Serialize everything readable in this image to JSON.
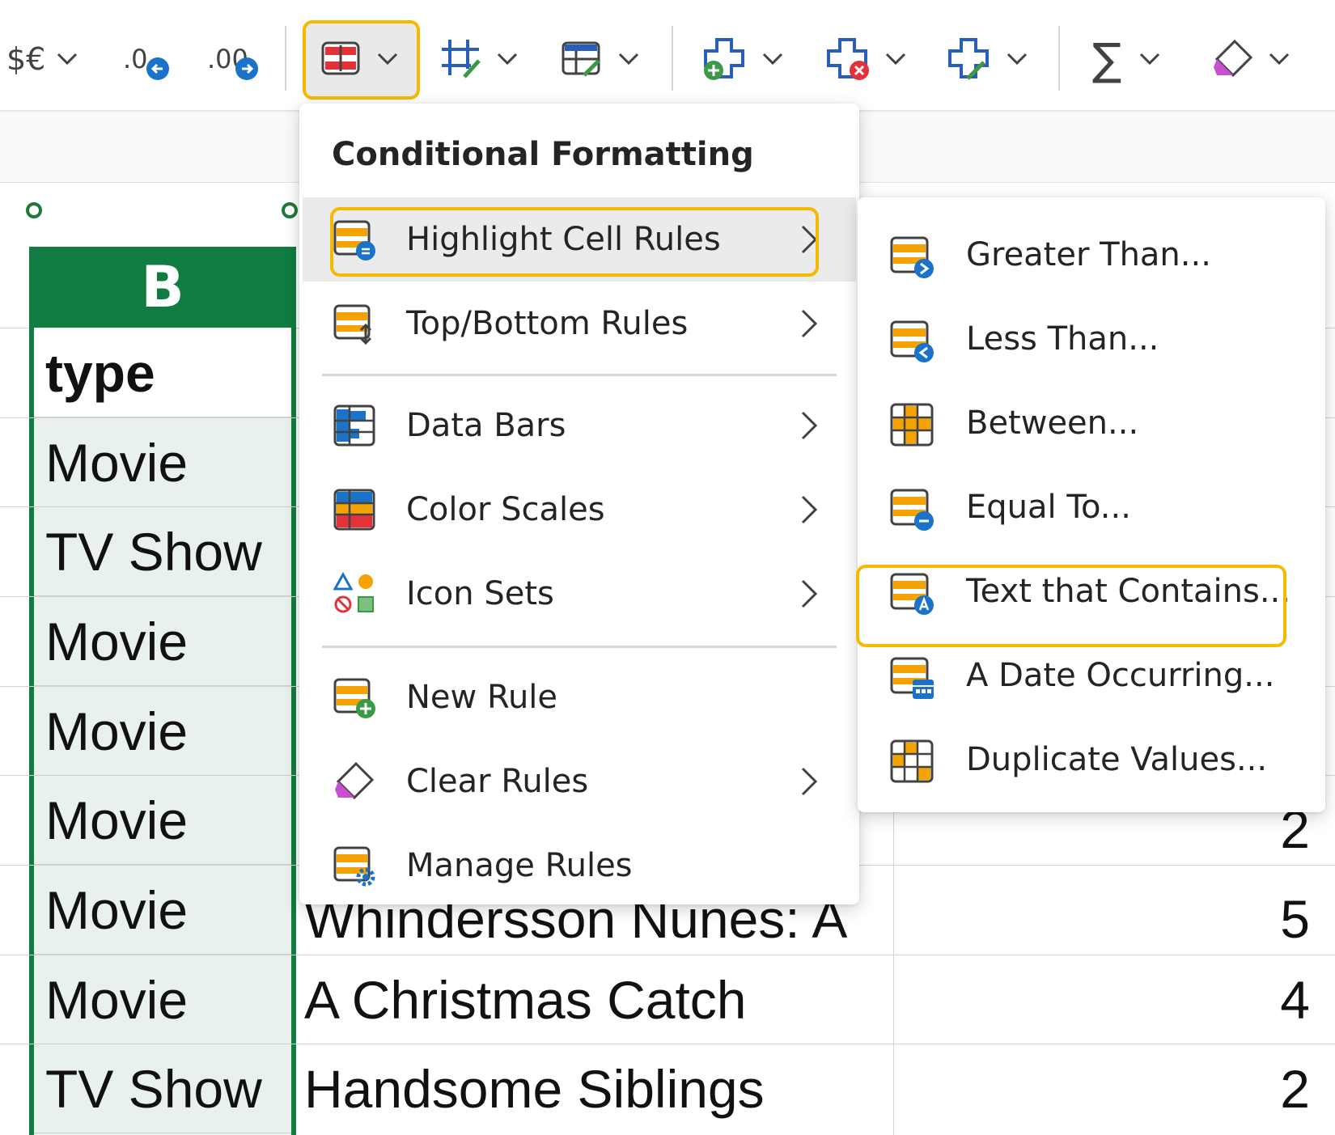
{
  "toolbar": {
    "currency_label": "$€",
    "decrease_decimal_label": ".0",
    "increase_decimal_label": ".00"
  },
  "menu": {
    "title": "Conditional Formatting",
    "items": [
      {
        "label": "Highlight Cell Rules",
        "icon": "highlight-cell-rules-icon",
        "has_submenu": true,
        "active": true
      },
      {
        "label": "Top/Bottom Rules",
        "icon": "top-bottom-rules-icon",
        "has_submenu": true
      },
      {
        "label": "Data Bars",
        "icon": "data-bars-icon",
        "has_submenu": true
      },
      {
        "label": "Color Scales",
        "icon": "color-scales-icon",
        "has_submenu": true
      },
      {
        "label": "Icon Sets",
        "icon": "icon-sets-icon",
        "has_submenu": true
      },
      {
        "label": "New Rule",
        "icon": "new-rule-icon",
        "has_submenu": false
      },
      {
        "label": "Clear Rules",
        "icon": "clear-rules-icon",
        "has_submenu": true
      },
      {
        "label": "Manage Rules",
        "icon": "manage-rules-icon",
        "has_submenu": false
      }
    ]
  },
  "submenu": {
    "items": [
      {
        "label": "Greater Than...",
        "icon": "greater-than-icon"
      },
      {
        "label": "Less Than...",
        "icon": "less-than-icon"
      },
      {
        "label": "Between...",
        "icon": "between-icon"
      },
      {
        "label": "Equal To...",
        "icon": "equal-to-icon"
      },
      {
        "label": "Text that Contains...",
        "icon": "text-contains-icon"
      },
      {
        "label": "A Date Occurring...",
        "icon": "date-occurring-icon"
      },
      {
        "label": "Duplicate Values...",
        "icon": "duplicate-values-icon"
      }
    ]
  },
  "sheet": {
    "column_b_header": "B",
    "column_b": [
      "type",
      "Movie",
      "TV Show",
      "Movie",
      "Movie",
      "Movie",
      "Movie",
      "Movie",
      "TV Show"
    ],
    "rows_visible": [
      {
        "title": "",
        "value": "2"
      },
      {
        "title": "Whindersson Nunes: A",
        "value": "5"
      },
      {
        "title": "A Christmas Catch",
        "value": "4"
      },
      {
        "title": "Handsome Siblings",
        "value": "2"
      }
    ]
  },
  "colors": {
    "accent_highlight": "#f6b800",
    "excel_green": "#107c41",
    "rule_orange": "#f4a300",
    "rule_blue": "#1a73c8"
  }
}
